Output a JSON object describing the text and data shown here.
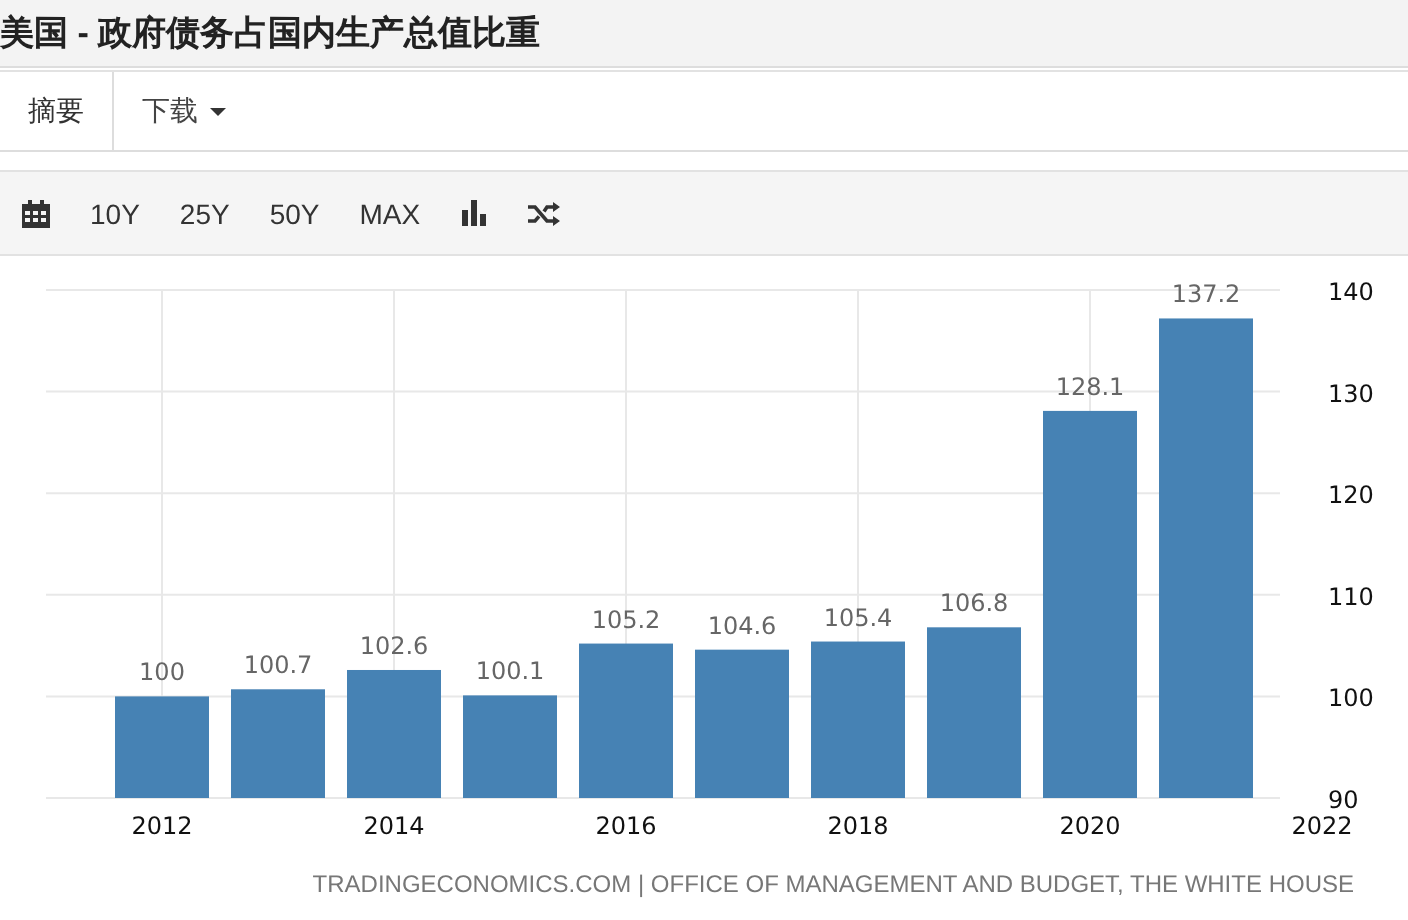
{
  "title": "美国 - 政府债务占国内生产总值比重",
  "tabs": [
    {
      "label": "摘要",
      "selected": true,
      "kind": "tab"
    },
    {
      "label": "下载",
      "selected": false,
      "kind": "dropdown"
    }
  ],
  "toolbar": {
    "ranges": [
      "10Y",
      "25Y",
      "50Y",
      "MAX"
    ]
  },
  "chart_data": {
    "type": "bar",
    "x": [
      2012,
      2013,
      2014,
      2015,
      2016,
      2017,
      2018,
      2019,
      2020,
      2021
    ],
    "series": [
      {
        "color": "#4682b4",
        "values": [
          100,
          100.7,
          102.6,
          100.1,
          105.2,
          104.6,
          105.4,
          106.8,
          128.1,
          137.2
        ]
      }
    ],
    "grid": true,
    "xlim": [
      2011,
      2022
    ],
    "ylim": [
      90,
      140
    ],
    "yticks": [
      90,
      100,
      110,
      120,
      130,
      140
    ],
    "xticks": [
      2012,
      2014,
      2016,
      2018,
      2020,
      2022
    ],
    "data_labels": true
  },
  "source": "TRADINGECONOMICS.COM | OFFICE OF MANAGEMENT AND BUDGET, THE WHITE HOUSE"
}
